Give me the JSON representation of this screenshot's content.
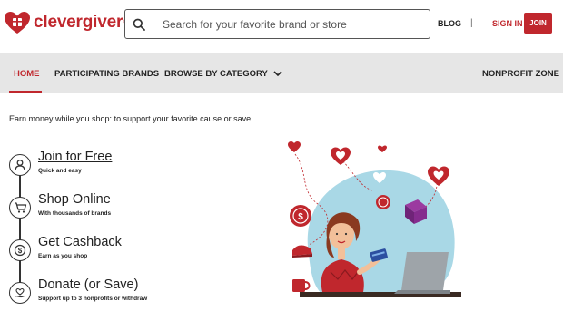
{
  "header": {
    "logo_text": "clevergiver",
    "logo_reg": "®",
    "search_placeholder": "Search for your favorite brand or store",
    "blog_label": "BLOG",
    "divider": "|",
    "signin_label": "SIGN IN",
    "join_label": "JOIN",
    "icons": {
      "search": "search-icon",
      "logo": "heart-gift-icon"
    }
  },
  "nav": {
    "items": [
      {
        "label": "HOME",
        "active": true
      },
      {
        "label": "PARTICIPATING BRANDS",
        "active": false
      },
      {
        "label": "BROWSE BY CATEGORY",
        "active": false,
        "icon": "chevron-down-icon"
      },
      {
        "label": "NONPROFIT ZONE",
        "active": false
      }
    ]
  },
  "main": {
    "tagline": "Earn money while you shop: to support your favorite cause or save",
    "steps": [
      {
        "title": "Join for Free",
        "subtitle": "Quick and easy",
        "icon": "user-icon"
      },
      {
        "title": "Shop Online",
        "subtitle": "With thousands of brands",
        "icon": "cart-icon"
      },
      {
        "title": "Get Cashback",
        "subtitle": "Earn as you shop",
        "icon": "dollar-coin-icon"
      },
      {
        "title": "Donate (or Save)",
        "subtitle": "Support up to 3 nonprofits or withdraw",
        "icon": "heart-hand-icon"
      }
    ]
  },
  "colors": {
    "brand": "#c0272d",
    "nav_bg": "#e6e6e6",
    "illustration_blob": "#a9d8e6"
  }
}
